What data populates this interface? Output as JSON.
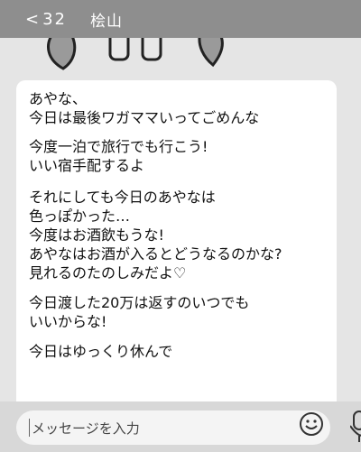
{
  "header": {
    "back_glyph": "<",
    "unread_count": "32",
    "chat_title": "桧山"
  },
  "message": {
    "paragraphs": [
      "あやな、\n今日は最後ワガママいってごめんな",
      "今度一泊で旅行でも行こう!\nいい宿手配するよ",
      "それにしても今日のあやなは\n色っぽかった…\n今度はお酒飲もうな!\nあやなはお酒が入るとどうなるのかな?\n見れるのたのしみだよ♡",
      "今日渡した20万は返すのいつでも\nいいからな!",
      "今日はゆっくり休んで"
    ]
  },
  "composer": {
    "placeholder": "メッセージを入力"
  },
  "icons": {
    "emoji": "emoji-icon",
    "mic": "microphone-icon",
    "back": "back-chevron-icon"
  }
}
